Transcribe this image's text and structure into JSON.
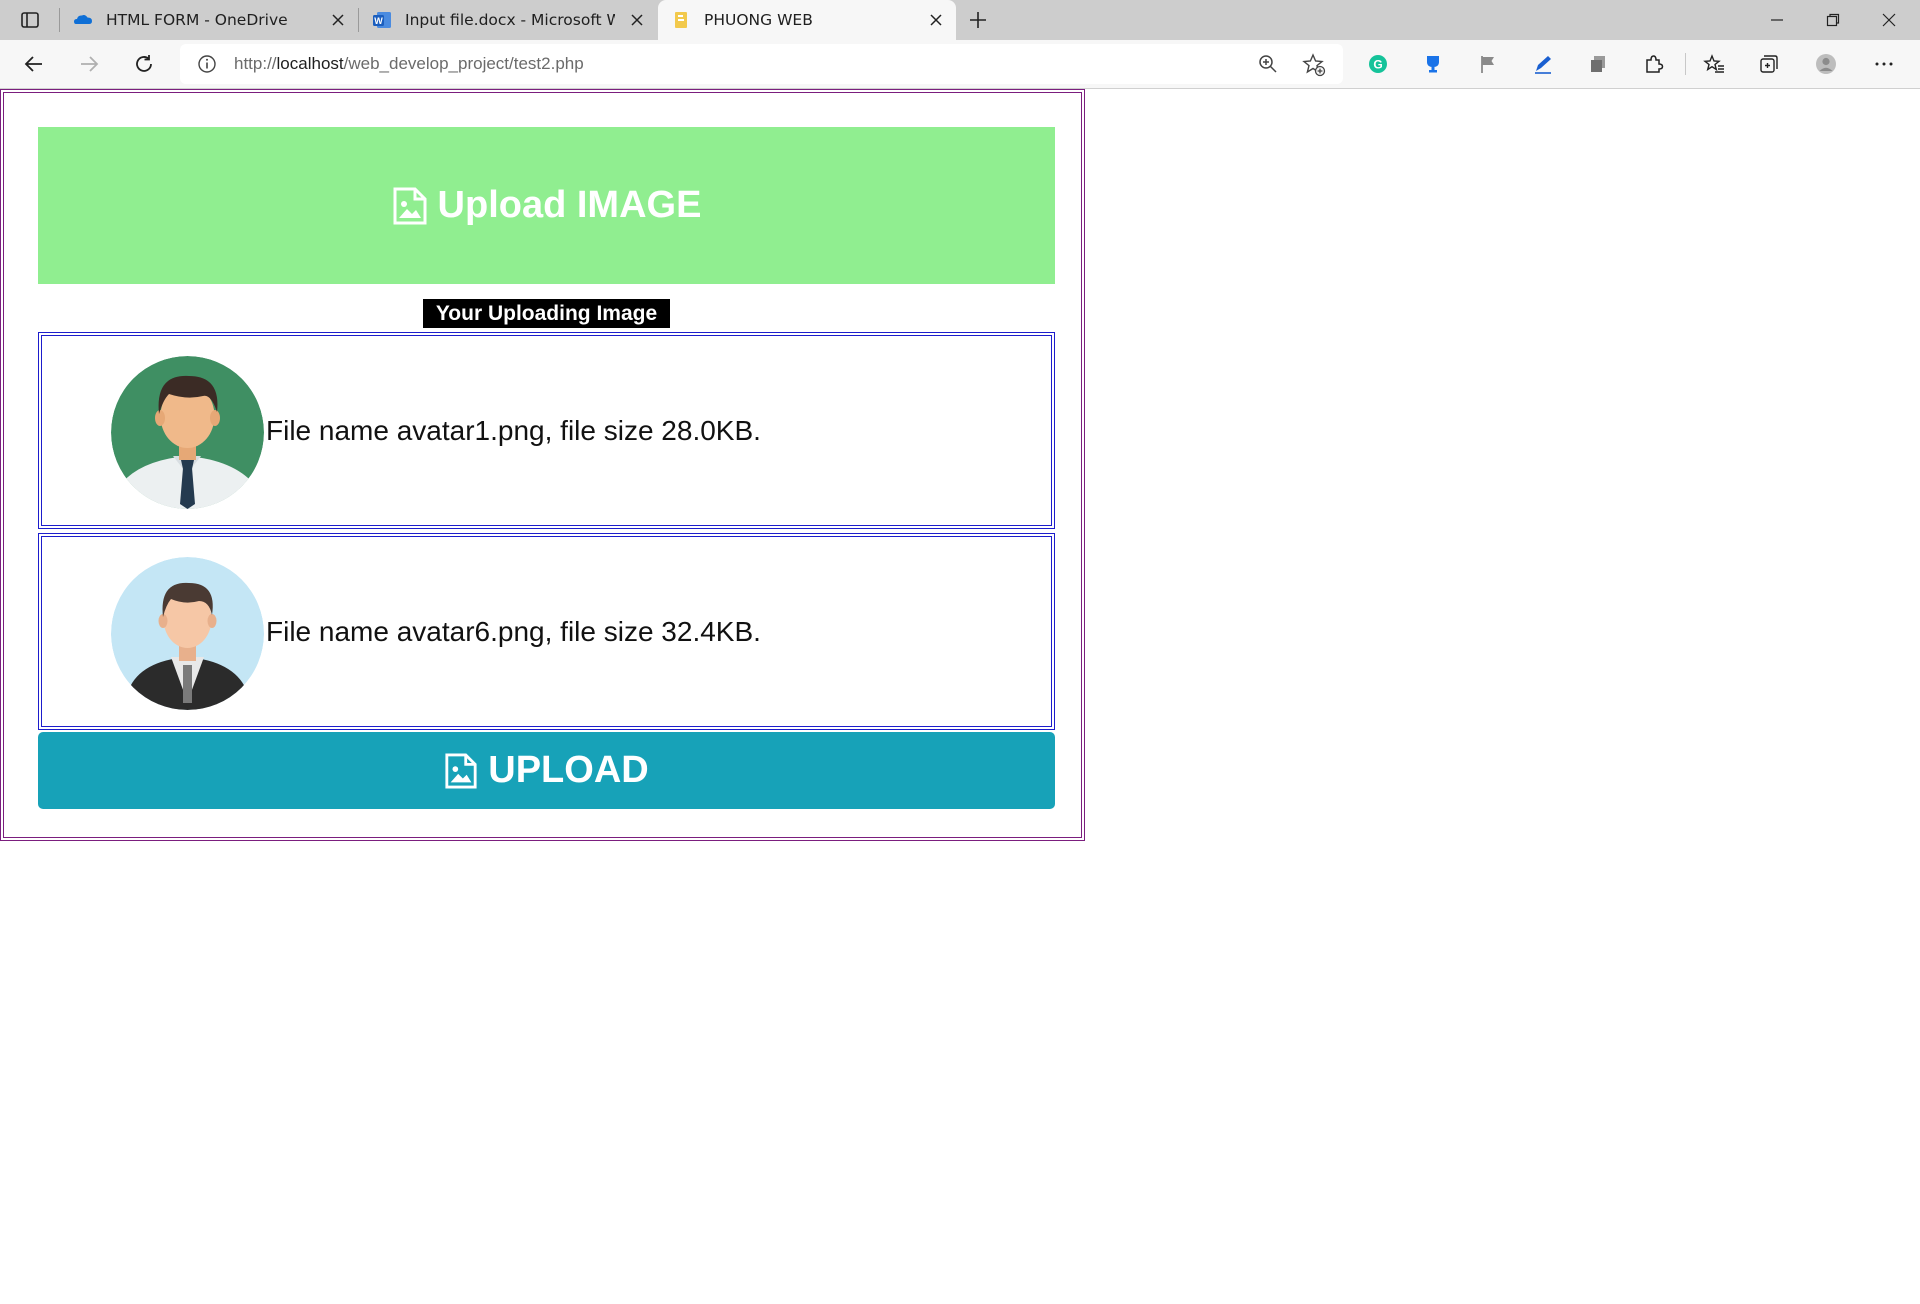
{
  "browser": {
    "tabs": [
      {
        "title": "HTML FORM - OneDrive",
        "icon": "onedrive-icon"
      },
      {
        "title": "Input file.docx - Microsoft Word",
        "icon": "word-icon"
      },
      {
        "title": "PHUONG WEB",
        "icon": "page-icon"
      }
    ],
    "active_tab": 2,
    "url_prefix": "http://",
    "url_host": "localhost",
    "url_path": "/web_develop_project/test2.php"
  },
  "page": {
    "banner_title": "Upload IMAGE",
    "caption": "Your Uploading Image",
    "files": [
      {
        "text": "File name avatar1.png, file size 28.0KB."
      },
      {
        "text": "File name avatar6.png, file size 32.4KB."
      }
    ],
    "upload_label": "UPLOAD"
  },
  "colors": {
    "banner_bg": "#90ee90",
    "upload_bg": "#17a2b8",
    "frame_border": "#7b1e7e",
    "file_border": "#1d1dcc"
  }
}
